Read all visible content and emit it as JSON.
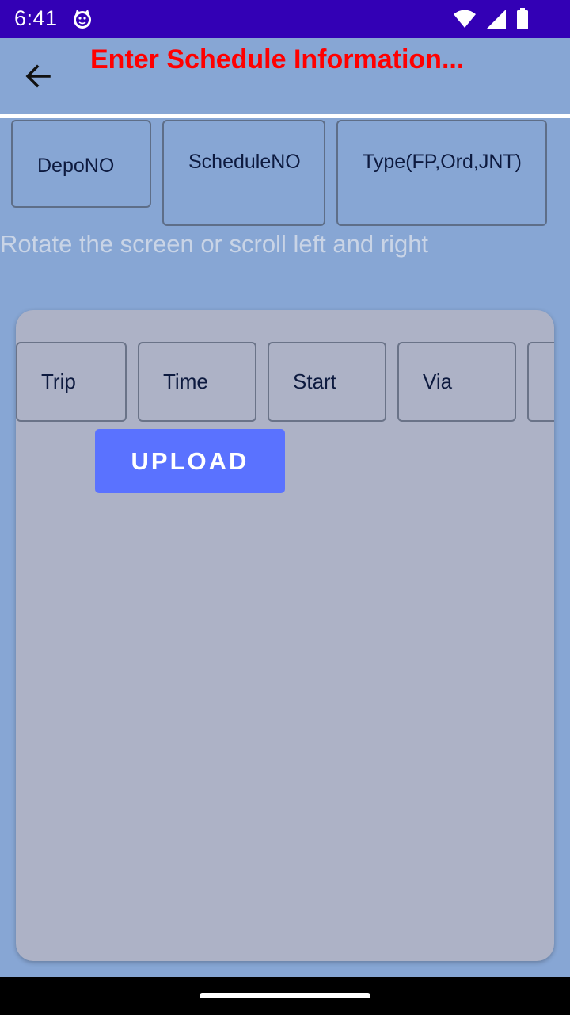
{
  "status_bar": {
    "time": "6:41",
    "icons": [
      "cat-icon",
      "wifi-icon",
      "signal-icon",
      "battery-icon"
    ]
  },
  "app_bar": {
    "title": "Enter Schedule Information...",
    "back_icon": "arrow-back-icon",
    "title_color": "#ff0000",
    "background": "#87a6d4"
  },
  "header_fields": [
    {
      "label": "DepoNO"
    },
    {
      "label": "ScheduleNO"
    },
    {
      "label": "Type(FP,Ord,JNT)"
    }
  ],
  "hint": "Rotate the screen or scroll left and right",
  "table": {
    "columns": [
      "Trip",
      "Time",
      "Start",
      "Via",
      ""
    ]
  },
  "upload_button": {
    "label": "UPLOAD",
    "color": "#5a72ff"
  }
}
